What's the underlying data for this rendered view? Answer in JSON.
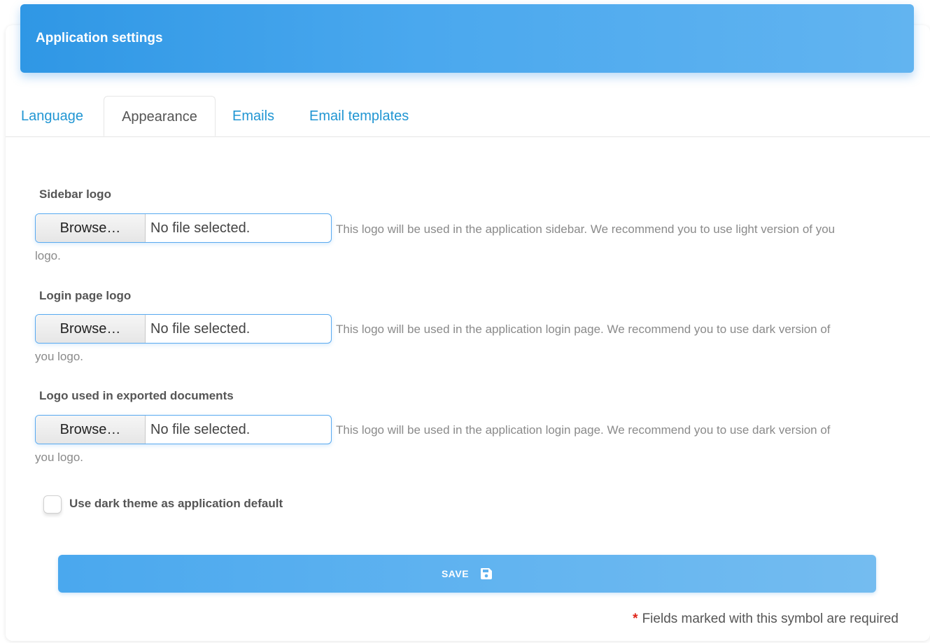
{
  "header": {
    "title": "Application settings"
  },
  "tabs": [
    {
      "label": "Language"
    },
    {
      "label": "Appearance"
    },
    {
      "label": "Emails"
    },
    {
      "label": "Email templates"
    }
  ],
  "fields": [
    {
      "label": "Sidebar logo",
      "browse_label": "Browse…",
      "file_status": "No file selected.",
      "help_line1": "This logo will be used in the application sidebar. We recommend you to use light version of you",
      "help_line2": "logo."
    },
    {
      "label": "Login page logo",
      "browse_label": "Browse…",
      "file_status": "No file selected.",
      "help_line1": "This logo will be used in the application login page. We recommend you to use dark version of",
      "help_line2": "you logo."
    },
    {
      "label": "Logo used in exported documents",
      "browse_label": "Browse…",
      "file_status": "No file selected.",
      "help_line1": "This logo will be used in the application login page. We recommend you to use dark version of",
      "help_line2": "you logo."
    }
  ],
  "dark_theme": {
    "label": "Use dark theme as application default",
    "checked": false
  },
  "save": {
    "label": "SAVE",
    "icon": "floppy-disk-icon"
  },
  "required_note": {
    "star": "*",
    "text": "Fields marked with this symbol are required"
  },
  "colors": {
    "accent": "#2f97e5",
    "tab_link": "#2196d3",
    "required": "#e0261b"
  }
}
